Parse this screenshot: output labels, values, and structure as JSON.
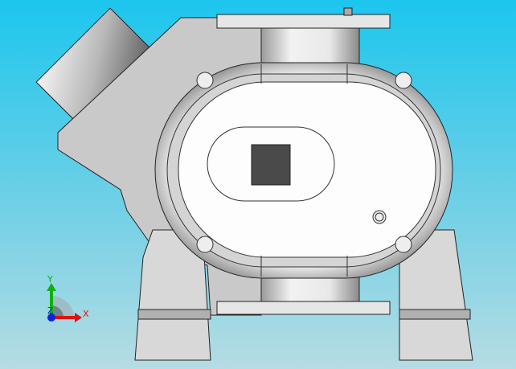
{
  "viewport": {
    "background_top": "#1cc6ee",
    "background_bottom": "#b6dce4"
  },
  "triad": {
    "x_label": "X",
    "y_label": "Y",
    "z_label": "Z",
    "x_color": "#e01010",
    "y_color": "#10b010",
    "z_color": "#1020e0"
  }
}
